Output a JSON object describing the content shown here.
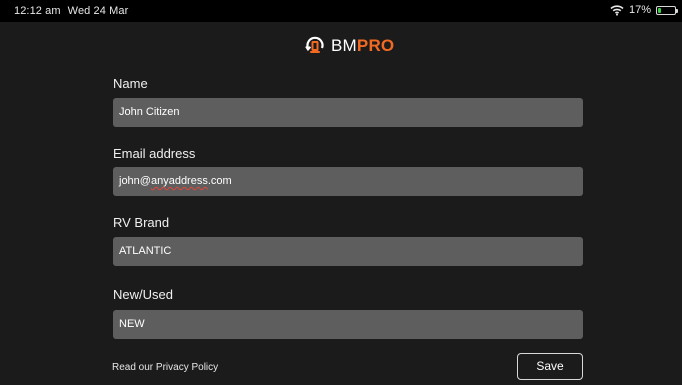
{
  "status_bar": {
    "time": "12:12 am",
    "date": "Wed 24 Mar",
    "battery_percent": "17%",
    "battery_level": 0.17,
    "icons": [
      "wifi-icon",
      "battery-icon"
    ]
  },
  "header": {
    "logo_bm": "BM",
    "logo_pro": "PRO",
    "accent_color": "#f26a22"
  },
  "form": {
    "name": {
      "label": "Name",
      "value": "John Citizen"
    },
    "email": {
      "label": "Email address",
      "value_prefix": "john@",
      "value_misspelled": "anyaddress",
      "value_suffix": ".com"
    },
    "rv_brand": {
      "label": "RV Brand",
      "value": "ATLANTIC"
    },
    "new_used": {
      "label": "New/Used",
      "value": "NEW"
    }
  },
  "footer": {
    "privacy_link": "Read our Privacy Policy",
    "save_label": "Save"
  }
}
